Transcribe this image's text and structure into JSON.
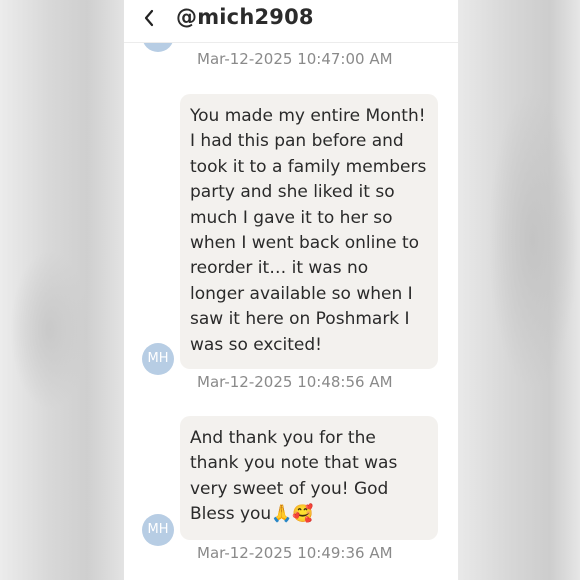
{
  "header": {
    "username": "@mich2908",
    "back_icon": "chevron-left-icon"
  },
  "messages": [
    {
      "avatar_initials": "MH",
      "text": "",
      "timestamp": "Mar-12-2025 10:47:00 AM"
    },
    {
      "avatar_initials": "MH",
      "text": "You made my entire Month! I had this pan before and took it to a family members party and she liked it so much I gave it to her so when I went back online to reorder it… it was no longer available so when I saw it here on Poshmark I was so excited!",
      "timestamp": "Mar-12-2025 10:48:56 AM"
    },
    {
      "avatar_initials": "MH",
      "text": "And thank you for the thank you note that was very sweet of you! God Bless you🙏🥰",
      "timestamp": "Mar-12-2025 10:49:36 AM"
    }
  ],
  "colors": {
    "bubble": "#f3f1ee",
    "avatar": "#b7cde4",
    "timestamp": "#8a8a8a",
    "text": "#2a2a2a"
  }
}
